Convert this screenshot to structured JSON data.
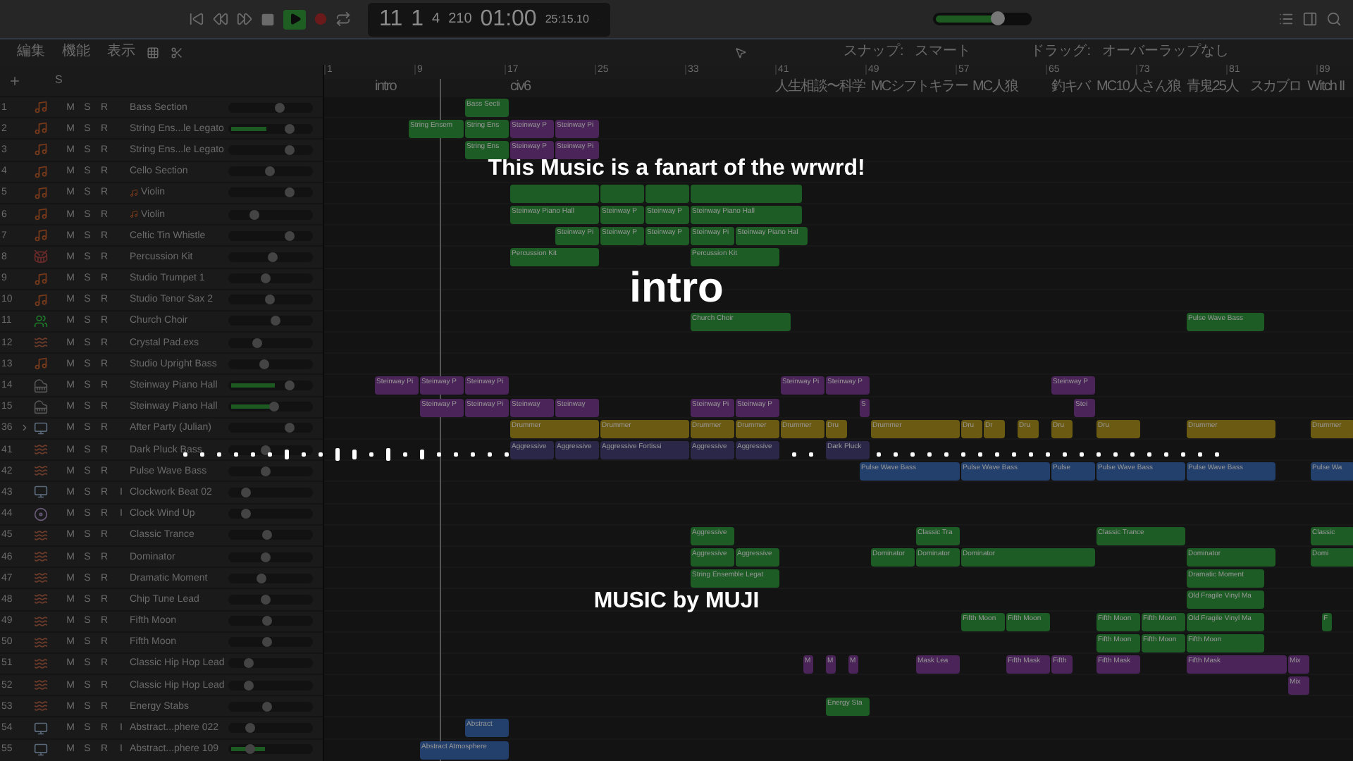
{
  "transport": {
    "bar": "11",
    "beat": "1",
    "division": "4",
    "tick": "210",
    "time": "01:00",
    "frames": "25:15.10"
  },
  "master_volume": {
    "level": 0.67
  },
  "edit_menus": [
    "編集",
    "機能",
    "表示"
  ],
  "snap": {
    "label": "スナップ:",
    "value": "スマート"
  },
  "drag": {
    "label": "ドラッグ:",
    "value": "オーバーラップなし"
  },
  "track_header": {
    "solo": "S"
  },
  "ruler": [
    "1",
    "9",
    "17",
    "25",
    "33",
    "41",
    "49",
    "57",
    "65",
    "73",
    "81",
    "89"
  ],
  "markers": [
    "intro",
    "civ6",
    "人生相談〜科学",
    "MCシフトキラー",
    "MC人狼",
    "釣キバ",
    "MC10人さん狼",
    "青鬼25人",
    "スカブロ",
    "Witch II"
  ],
  "tracks": [
    {
      "number": "1",
      "name": "Bass Section",
      "kind": "instrument",
      "buttons": [
        "M",
        "S",
        "R"
      ],
      "level": 0.6,
      "regions": [
        {
          "label": "Bass Secti",
          "color": "#1d5c25"
        }
      ]
    },
    {
      "number": "2",
      "name": "String Ens...le Legato",
      "kind": "instrument",
      "buttons": [
        "M",
        "S",
        "R"
      ],
      "level": 0.72,
      "meter": {
        "level": 0.42
      },
      "regions": [
        {
          "label": "String Ensem",
          "color": "#1d5c25"
        },
        {
          "label": "String Ens",
          "color": "#1d5c25"
        },
        {
          "label": "Steinway P",
          "color": "#4b2459"
        },
        {
          "label": "Steinway Pi",
          "color": "#4b2459"
        }
      ]
    },
    {
      "number": "3",
      "name": "String Ens...le Legato",
      "kind": "instrument",
      "buttons": [
        "M",
        "S",
        "R"
      ],
      "level": 0.72,
      "regions": [
        {
          "label": "String Ens",
          "color": "#1d5c25"
        },
        {
          "label": "Steinway P",
          "color": "#4b2459"
        },
        {
          "label": "Steinway Pi",
          "color": "#4b2459"
        }
      ]
    },
    {
      "number": "4",
      "name": "Cello Section",
      "kind": "instrument",
      "buttons": [
        "M",
        "S",
        "R"
      ],
      "level": 0.48
    },
    {
      "number": "5",
      "name": "Violin",
      "kind": "instrument",
      "name_icon": true,
      "buttons": [
        "M",
        "S",
        "R"
      ],
      "level": 0.72,
      "regions": [
        {
          "color": "#1d5c25"
        },
        {
          "color": "#1d5c25"
        },
        {
          "color": "#1d5c25"
        },
        {
          "color": "#1d5c25"
        }
      ]
    },
    {
      "number": "6",
      "name": "Violin",
      "kind": "instrument",
      "name_icon": true,
      "buttons": [
        "M",
        "S",
        "R"
      ],
      "level": 0.3,
      "regions": [
        {
          "label": "Steinway Piano Hall",
          "color": "#1d5c25"
        },
        {
          "label": "Steinway P",
          "color": "#1d5c25"
        },
        {
          "label": "Steinway P",
          "color": "#1d5c25"
        },
        {
          "label": "Steinway Piano Hall",
          "color": "#1d5c25"
        }
      ]
    },
    {
      "number": "7",
      "name": "Celtic Tin Whistle",
      "kind": "instrument",
      "buttons": [
        "M",
        "S",
        "R"
      ],
      "level": 0.72,
      "regions": [
        {
          "label": "Steinway Pi",
          "color": "#1d5c25"
        },
        {
          "label": "Steinway P",
          "color": "#1d5c25"
        },
        {
          "label": "Steinway P",
          "color": "#1d5c25"
        },
        {
          "label": "Steinway Pi",
          "color": "#1d5c25"
        },
        {
          "label": "Steinway Piano Hal",
          "color": "#1d5c25"
        }
      ]
    },
    {
      "number": "8",
      "name": "Percussion Kit",
      "kind": "drums",
      "buttons": [
        "M",
        "S",
        "R"
      ],
      "level": 0.52,
      "regions": [
        {
          "label": "Percussion Kit",
          "color": "#1d5c25"
        },
        {
          "label": "Percussion Kit",
          "color": "#1d5c25"
        }
      ]
    },
    {
      "number": "9",
      "name": "Studio Trumpet 1",
      "kind": "instrument",
      "buttons": [
        "M",
        "S",
        "R"
      ],
      "level": 0.43
    },
    {
      "number": "10",
      "name": "Studio Tenor Sax 2",
      "kind": "instrument",
      "buttons": [
        "M",
        "S",
        "R"
      ],
      "level": 0.48
    },
    {
      "number": "11",
      "name": "Church Choir",
      "kind": "choir",
      "buttons": [
        "M",
        "S",
        "R"
      ],
      "level": 0.55,
      "regions": [
        {
          "label": "Church Choir",
          "color": "#1d5c25"
        },
        {
          "label": "Pulse Wave Bass",
          "color": "#1d5c25"
        }
      ]
    },
    {
      "number": "12",
      "name": "Crystal Pad.exs",
      "kind": "synth",
      "buttons": [
        "M",
        "S",
        "R"
      ],
      "level": 0.34
    },
    {
      "number": "13",
      "name": "Studio Upright Bass",
      "kind": "instrument",
      "buttons": [
        "M",
        "S",
        "R"
      ],
      "level": 0.41
    },
    {
      "number": "14",
      "name": "Steinway Piano Hall",
      "kind": "piano",
      "buttons": [
        "M",
        "S",
        "R"
      ],
      "level": 0.72,
      "meter": {
        "level": 0.52
      },
      "regions": [
        {
          "label": "Steinway Pi",
          "color": "#4b2459"
        },
        {
          "label": "Steinway P",
          "color": "#4b2459"
        },
        {
          "label": "Steinway Pi",
          "color": "#4b2459"
        },
        {
          "label": "Steinway Pi",
          "color": "#4b2459"
        },
        {
          "label": "Steinway P",
          "color": "#4b2459"
        },
        {
          "label": "Steinway P",
          "color": "#4b2459"
        }
      ]
    },
    {
      "number": "15",
      "name": "Steinway Piano Hall",
      "kind": "piano",
      "buttons": [
        "M",
        "S",
        "R"
      ],
      "level": 0.53,
      "meter": {
        "level": 0.48
      },
      "regions": [
        {
          "label": "Steinway P",
          "color": "#4b2459"
        },
        {
          "label": "Steinway Pi",
          "color": "#4b2459"
        },
        {
          "label": "Steinway",
          "color": "#4b2459"
        },
        {
          "label": "Steinway",
          "color": "#4b2459"
        },
        {
          "label": "Steinway Pi",
          "color": "#4b2459"
        },
        {
          "label": "Steinway P",
          "color": "#4b2459"
        },
        {
          "label": "S",
          "color": "#4b2459"
        },
        {
          "label": "Stei",
          "color": "#4b2459"
        }
      ]
    },
    {
      "number": "36",
      "name": "After Party (Julian)",
      "kind": "audio",
      "stack": true,
      "buttons": [
        "M",
        "S",
        "R"
      ],
      "level": 0.72,
      "regions": [
        {
          "label": "Drummer",
          "color": "#6b5a12"
        },
        {
          "label": "Drummer",
          "color": "#6b5a12"
        },
        {
          "label": "Drummer",
          "color": "#6b5a12"
        },
        {
          "label": "Drummer",
          "color": "#6b5a12"
        },
        {
          "label": "Drummer",
          "color": "#6b5a12"
        },
        {
          "label": "Dru",
          "color": "#6b5a12"
        },
        {
          "label": "Drummer",
          "color": "#6b5a12"
        },
        {
          "label": "Dru",
          "color": "#6b5a12"
        },
        {
          "label": "Dr",
          "color": "#6b5a12"
        },
        {
          "label": "Dru",
          "color": "#6b5a12"
        },
        {
          "label": "Dru",
          "color": "#6b5a12"
        },
        {
          "label": "Dru",
          "color": "#6b5a12"
        },
        {
          "label": "Drummer",
          "color": "#6b5a12"
        },
        {
          "label": "Drummer",
          "color": "#6b5a12"
        }
      ]
    },
    {
      "number": "41",
      "name": "Dark Pluck Bass",
      "kind": "synth",
      "buttons": [
        "M",
        "S",
        "R"
      ],
      "level": 0.43,
      "regions": [
        {
          "label": "Aggressive",
          "color": "#2b2748"
        },
        {
          "label": "Aggressive",
          "color": "#2b2748"
        },
        {
          "label": "Aggressive Fortissi",
          "color": "#2b2748"
        },
        {
          "label": "Aggressive",
          "color": "#2b2748"
        },
        {
          "label": "Aggressive",
          "color": "#2b2748"
        },
        {
          "label": "Dark Pluck",
          "color": "#2b2748"
        }
      ]
    },
    {
      "number": "42",
      "name": "Pulse Wave Bass",
      "kind": "synth",
      "buttons": [
        "M",
        "S",
        "R"
      ],
      "level": 0.43,
      "regions": [
        {
          "label": "Pulse Wave Bass",
          "color": "#233f6b"
        },
        {
          "label": "Pulse Wave Bass",
          "color": "#233f6b"
        },
        {
          "label": "Pulse",
          "color": "#233f6b"
        },
        {
          "label": "Pulse Wave Bass",
          "color": "#233f6b"
        },
        {
          "label": "Pulse Wave Bass",
          "color": "#233f6b"
        },
        {
          "label": "Pulse Wa",
          "color": "#233f6b"
        }
      ]
    },
    {
      "number": "43",
      "name": "Clockwork Beat 02",
      "kind": "audio",
      "buttons": [
        "M",
        "S",
        "R",
        "I"
      ],
      "level": 0.2
    },
    {
      "number": "44",
      "name": "Clock Wind Up",
      "kind": "sample",
      "buttons": [
        "M",
        "S",
        "R",
        "I"
      ],
      "level": 0.2
    },
    {
      "number": "45",
      "name": "Classic Trance",
      "kind": "synth",
      "buttons": [
        "M",
        "S",
        "R"
      ],
      "level": 0.45,
      "regions": [
        {
          "label": "Aggressive",
          "color": "#1d5c25"
        },
        {
          "label": "Classic Tra",
          "color": "#1d5c25"
        },
        {
          "label": "Classic Trance",
          "color": "#1d5c25"
        },
        {
          "label": "Classic",
          "color": "#1d5c25"
        }
      ]
    },
    {
      "number": "46",
      "name": "Dominator",
      "kind": "synth",
      "buttons": [
        "M",
        "S",
        "R"
      ],
      "level": 0.43,
      "regions": [
        {
          "label": "Aggressive",
          "color": "#1d5c25"
        },
        {
          "label": "Aggressive",
          "color": "#1d5c25"
        },
        {
          "label": "Dominator",
          "color": "#1d5c25"
        },
        {
          "label": "Dominator",
          "color": "#1d5c25"
        },
        {
          "label": "Dominator",
          "color": "#1d5c25"
        },
        {
          "label": "Dominator",
          "color": "#1d5c25"
        },
        {
          "label": "Domi",
          "color": "#1d5c25"
        }
      ]
    },
    {
      "number": "47",
      "name": "Dramatic Moment",
      "kind": "synth",
      "buttons": [
        "M",
        "S",
        "R"
      ],
      "level": 0.39,
      "regions": [
        {
          "label": "String Ensemble Legat",
          "color": "#1d5c25"
        },
        {
          "label": "Dramatic Moment",
          "color": "#1d5c25"
        }
      ]
    },
    {
      "number": "48",
      "name": "Chip Tune Lead",
      "kind": "synth",
      "buttons": [
        "M",
        "S",
        "R"
      ],
      "level": 0.43,
      "regions": [
        {
          "label": "Old Fragile Vinyl Ma",
          "color": "#1d5c25"
        }
      ]
    },
    {
      "number": "49",
      "name": "Fifth Moon",
      "kind": "synth",
      "buttons": [
        "M",
        "S",
        "R"
      ],
      "level": 0.45,
      "regions": [
        {
          "label": "Fifth Moon",
          "color": "#1d5c25"
        },
        {
          "label": "Fifth Moon",
          "color": "#1d5c25"
        },
        {
          "label": "Fifth Moon",
          "color": "#1d5c25"
        },
        {
          "label": "Fifth Moon",
          "color": "#1d5c25"
        },
        {
          "label": "Old Fragile Vinyl Ma",
          "color": "#1d5c25"
        },
        {
          "label": "F",
          "color": "#1d5c25"
        }
      ]
    },
    {
      "number": "50",
      "name": "Fifth Moon",
      "kind": "synth",
      "buttons": [
        "M",
        "S",
        "R"
      ],
      "level": 0.45,
      "regions": [
        {
          "label": "Fifth Moon",
          "color": "#1d5c25"
        },
        {
          "label": "Fifth Moon",
          "color": "#1d5c25"
        },
        {
          "label": "Fifth Moon",
          "color": "#1d5c25"
        }
      ]
    },
    {
      "number": "51",
      "name": "Classic Hip Hop Lead",
      "kind": "synth",
      "buttons": [
        "M",
        "S",
        "R"
      ],
      "level": 0.24,
      "regions": [
        {
          "label": "M",
          "color": "#4b2459"
        },
        {
          "label": "M",
          "color": "#4b2459"
        },
        {
          "label": "M",
          "color": "#4b2459"
        },
        {
          "label": "Mask Lea",
          "color": "#4b2459"
        },
        {
          "label": "Fifth Mask",
          "color": "#4b2459"
        },
        {
          "label": "Fifth",
          "color": "#4b2459"
        },
        {
          "label": "Fifth Mask",
          "color": "#4b2459"
        },
        {
          "label": "Fifth Mask",
          "color": "#4b2459"
        },
        {
          "label": "Mix",
          "color": "#4b2459"
        }
      ]
    },
    {
      "number": "52",
      "name": "Classic Hip Hop Lead",
      "kind": "synth",
      "buttons": [
        "M",
        "S",
        "R"
      ],
      "level": 0.24,
      "regions": [
        {
          "label": "Mix",
          "color": "#4b2459"
        }
      ]
    },
    {
      "number": "53",
      "name": "Energy Stabs",
      "kind": "synth",
      "buttons": [
        "M",
        "S",
        "R"
      ],
      "level": 0.45,
      "regions": [
        {
          "label": "Energy Sta",
          "color": "#1d5c25"
        }
      ]
    },
    {
      "number": "54",
      "name": "Abstract...phere 022",
      "kind": "audio",
      "buttons": [
        "M",
        "S",
        "R",
        "I"
      ],
      "level": 0.25,
      "regions": [
        {
          "label": "Abstract",
          "color": "#233f6b"
        }
      ]
    },
    {
      "number": "55",
      "name": "Abstract...phere 109",
      "kind": "audio",
      "buttons": [
        "M",
        "S",
        "R",
        "I"
      ],
      "level": 0.25,
      "meter": {
        "level": 0.4
      },
      "regions": [
        {
          "label": "Abstract Atmosphere",
          "color": "#233f6b"
        }
      ]
    }
  ],
  "overlay": {
    "caption": "This Music is a fanart of the wrwrd!",
    "title": "intro",
    "credit": "MUSIC by MUJI"
  }
}
